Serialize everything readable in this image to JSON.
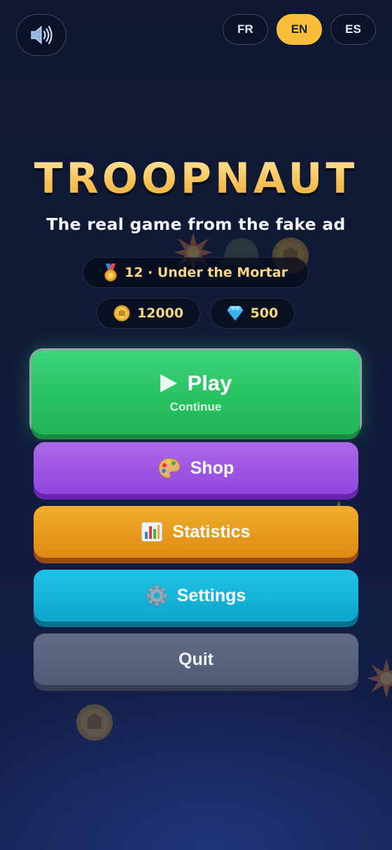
{
  "header": {
    "sound_icon": "speaker-icon",
    "languages": [
      {
        "code": "FR",
        "active": false
      },
      {
        "code": "EN",
        "active": true
      },
      {
        "code": "ES",
        "active": false
      }
    ]
  },
  "title": "TROOPNAUT",
  "subtitle": "The real game from the fake ad",
  "level": {
    "icon": "medal-icon",
    "label": "12 · Under the Mortar"
  },
  "currency": {
    "coins": {
      "icon": "coin-icon",
      "value": "12000"
    },
    "gems": {
      "icon": "gem-icon",
      "value": "500"
    }
  },
  "menu": {
    "play": {
      "icon": "play-icon",
      "label": "Play",
      "sub": "Continue",
      "color": "#27c160"
    },
    "shop": {
      "icon": "palette-icon",
      "label": "Shop",
      "color": "#9145dd"
    },
    "statistics": {
      "icon": "bar-chart-icon",
      "label": "Statistics",
      "color": "#df8a14"
    },
    "settings": {
      "icon": "gear-icon",
      "label": "Settings",
      "color": "#0fa5cc"
    },
    "quit": {
      "label": "Quit",
      "color": "#525b75"
    }
  },
  "colors": {
    "accent": "#f8be3c",
    "title_gold": "#f6c35c",
    "background": "#111b38"
  }
}
